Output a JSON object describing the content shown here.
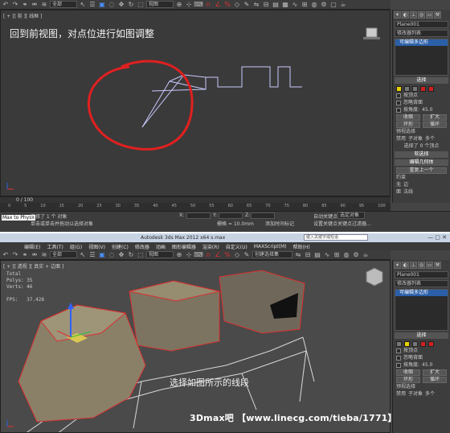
{
  "top": {
    "viewport_label": "[ + ][ 前 ][ 线框 ]",
    "caption": "回到前视图，对点位进行如图调整",
    "toolbar": {
      "selection_filter": "全部",
      "view_dropdown": "视图"
    },
    "command_panel": {
      "object_name": "Plane001",
      "modifier_list": "修改器列表",
      "stack_item": "可编辑多边形",
      "rollout_selection": "选择",
      "by_vertex": "按顶点",
      "ignore_backfacing": "忽略背面",
      "by_angle": "按角度:",
      "angle_value": "45.0",
      "shrink": "收缩",
      "grow": "扩大",
      "ring": "环形",
      "loop": "循环",
      "preview_selection": "预视选择",
      "preview_off": "禁用",
      "preview_subobject": "子对象",
      "preview_multi": "多个",
      "selected_count": "选择了 0 个顶点",
      "soft_selection": "软选择",
      "edit_geometry": "编辑几何体",
      "repeat_last": "重复上一个",
      "constraints": "约束",
      "constraint_none": "无",
      "constraint_edge": "边",
      "constraint_face": "面",
      "constraint_normal": "法线"
    },
    "timeline": {
      "frame": "0 / 100",
      "ticks": [
        "0",
        "5",
        "10",
        "15",
        "20",
        "25",
        "30",
        "35",
        "40",
        "45",
        "50",
        "55",
        "60",
        "65",
        "70",
        "75",
        "80",
        "85",
        "90",
        "95",
        "100"
      ]
    },
    "status": {
      "script_label": "Max to Physx",
      "selected": "选择了 1 个 对象",
      "prompt": "单击或单击并拖动以选择对象",
      "x_label": "X:",
      "y_label": "Y:",
      "z_label": "Z:",
      "grid": "栅格 = 10.0mm",
      "autokey": "自动关键点",
      "selected_object": "选定对象",
      "setkey": "设置关键点",
      "keyfilter": "关键点过滤器...",
      "add_time_tag": "添加时间标记"
    }
  },
  "bottom": {
    "title": "Autodesk 3ds Max  2012 x64      s.max",
    "search_placeholder": "键入关键字或短语",
    "menu": [
      "编辑(E)",
      "工具(T)",
      "组(G)",
      "视图(V)",
      "创建(C)",
      "修改器",
      "动画",
      "图形编辑器",
      "渲染(R)",
      "自定义(U)",
      "MAXScript(M)",
      "帮助(H)"
    ],
    "viewport_label": "[ + ][ 透视 ][ 真实 + 边面 ]",
    "stats": {
      "total": "Total",
      "polys": "Polys: 35",
      "verts": "Verts: 46",
      "fps": "FPS:   37.428"
    },
    "caption": "选择如图所示的线段",
    "toolbar": {
      "selection_filter": "全部",
      "view_dropdown": "视图",
      "named_selection": "创建选择集"
    },
    "command_panel": {
      "object_name": "Plane001",
      "modifier_list": "修改器列表",
      "stack_item": "可编辑多边形",
      "rollout_selection": "选择",
      "by_vertex": "按顶点",
      "ignore_backfacing": "忽略背面",
      "by_angle": "按角度:",
      "angle_value": "45.0",
      "shrink": "收缩",
      "grow": "扩大",
      "ring": "环形",
      "loop": "循环",
      "preview_selection": "预视选择",
      "preview_off": "禁用",
      "preview_subobject": "子对象",
      "preview_multi": "多个"
    },
    "watermark": "3Dmax吧 【www.linecg.com/tieba/1771】"
  },
  "colors": {
    "annotation_red": "#e02020",
    "selection_blue": "#2b5fa8",
    "edge_red": "#d83030",
    "mesh_fill": "#8a8068",
    "wire": "#c8c8ff"
  }
}
